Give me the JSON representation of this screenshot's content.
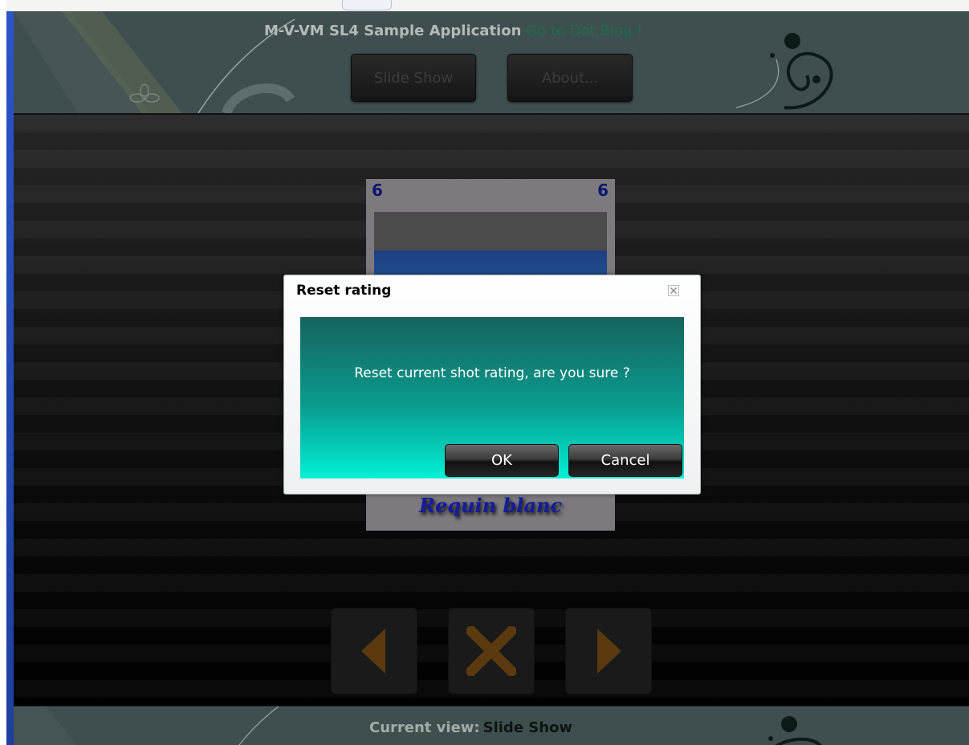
{
  "header": {
    "title": "M-V-VM SL4 Sample Application",
    "link_text": "Go to Dot.Blog !",
    "nav_buttons": [
      {
        "label": "Slide Show"
      },
      {
        "label": "About..."
      }
    ]
  },
  "photo": {
    "index_left": "6",
    "index_right": "6",
    "caption": "Requin blanc"
  },
  "controls": [
    {
      "icon": "previous-arrow-icon"
    },
    {
      "icon": "close-x-icon"
    },
    {
      "icon": "next-arrow-icon"
    }
  ],
  "dialog": {
    "title": "Reset rating",
    "message": "Reset current shot rating, are you sure ?",
    "ok_label": "OK",
    "cancel_label": "Cancel"
  },
  "footer": {
    "label": "Current view:",
    "value": "Slide Show"
  },
  "colors": {
    "header_bg": "#3f4f50",
    "title_link": "#1d6e4d",
    "dialog_gradient_top": "#17625e",
    "dialog_gradient_bottom": "#00f0d6",
    "control_icon": "#5a3a0e",
    "photo_number": "#0c1670",
    "caption": "#131c9c"
  }
}
